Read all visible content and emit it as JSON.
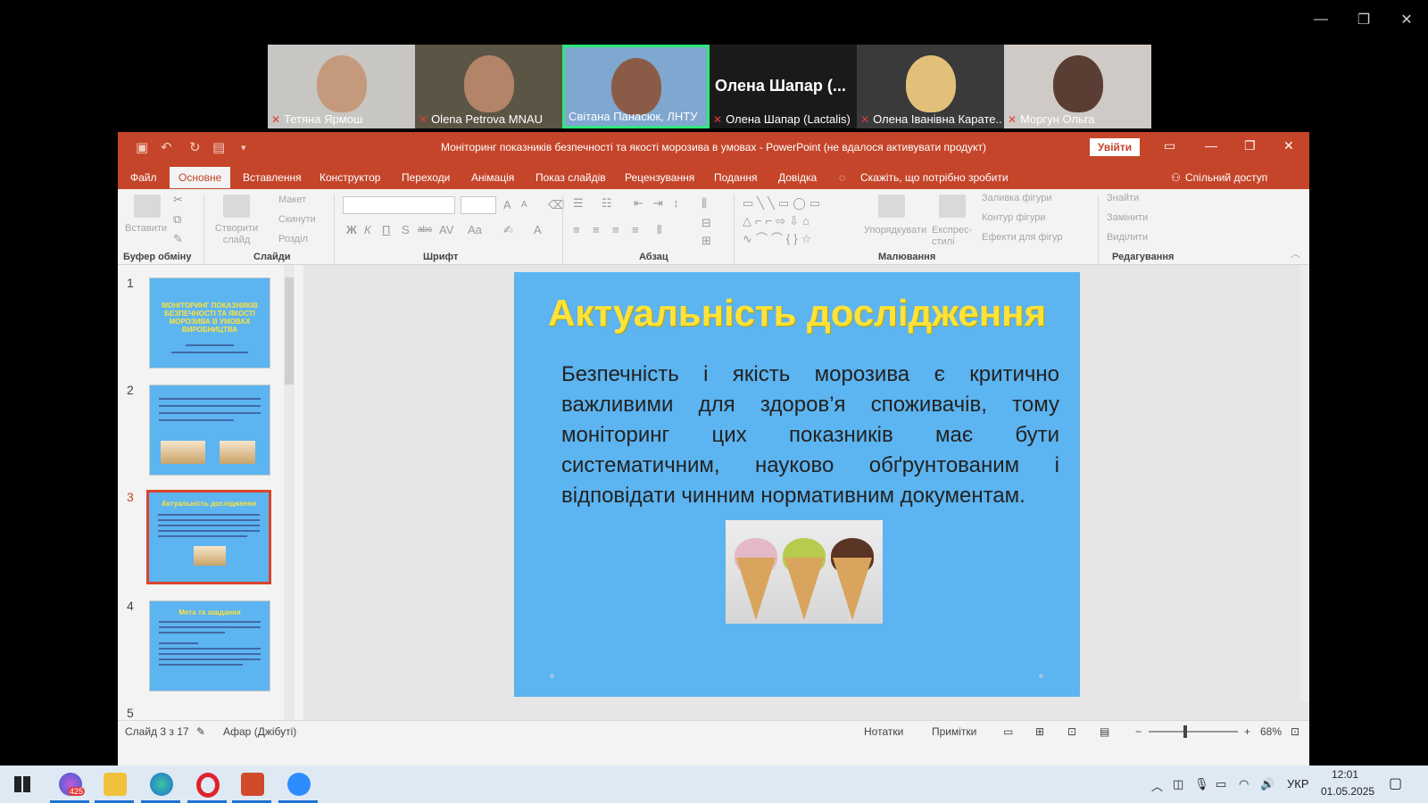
{
  "window_controls": {
    "minimize": "—",
    "restore": "❐",
    "close": "✕"
  },
  "participants": [
    {
      "name": "Тетяна Ярмош",
      "muted": true,
      "face": "#c59a7c",
      "bg": "#c8c6c2"
    },
    {
      "name": "Olena Petrova MNAU",
      "muted": true,
      "face": "#b38468",
      "bg": "#5b5546"
    },
    {
      "name": "Світана Панасюк, ЛНТУ",
      "muted": false,
      "face": "#8a5c47",
      "bg": "#7fa7cf",
      "active": true
    },
    {
      "name": "Олена Шапар (Lactalis)",
      "muted": true,
      "big": "Олена Шапар (..."
    },
    {
      "name": "Олена Іванівна Карате...",
      "muted": true,
      "face": "#e3c07a",
      "bg": "#3a3a3a"
    },
    {
      "name": "Моргун Ольга",
      "muted": true,
      "face": "#5a3e34",
      "bg": "#cfcac6"
    }
  ],
  "ppt": {
    "title": "Моніторинг показників безпечності та якості морозива в умовах  -  PowerPoint (не вдалося активувати продукт)",
    "signin": "Увійти",
    "tabs": [
      "Файл",
      "Основне",
      "Вставлення",
      "Конструктор",
      "Переходи",
      "Анімація",
      "Показ слайдів",
      "Рецензування",
      "Подання",
      "Довідка"
    ],
    "tell_me": "Скажіть, що потрібно зробити",
    "share": "Спільний доступ",
    "ribbon": {
      "clipboard": {
        "label": "Буфер обміну",
        "paste": "Вставити"
      },
      "slides": {
        "label": "Слайди",
        "new": "Створити слайд",
        "layout": "Макет",
        "reset": "Скинути",
        "section": "Розділ"
      },
      "font": {
        "label": "Шрифт",
        "bold": "Ж",
        "italic": "К",
        "underline": "П",
        "strike": "S",
        "shadow": "abc",
        "spacing": "AV",
        "case": "Aa"
      },
      "paragraph": {
        "label": "Абзац"
      },
      "drawing": {
        "label": "Малювання",
        "arrange": "Упорядкувати",
        "styles": "Експрес-стилі",
        "fill": "Заливка фігури",
        "outline": "Контур фігури",
        "effects": "Ефекти для фігур"
      },
      "editing": {
        "label": "Редагування",
        "find": "Знайти",
        "replace": "Замінити",
        "select": "Виділити"
      }
    },
    "thumbnails": [
      {
        "num": "1",
        "title": "МОНІТОРИНГ ПОКАЗНИКІВ БЕЗПЕЧНОСТІ ТА ЯКОСТІ МОРОЗИВА В УМОВАХ ВИРОБНИЦТВА"
      },
      {
        "num": "2",
        "title": ""
      },
      {
        "num": "3",
        "title": "Актуальність дослідження",
        "selected": true
      },
      {
        "num": "4",
        "title": "Мета та завдання"
      },
      {
        "num": "5",
        "title": ""
      }
    ],
    "slide": {
      "title": "Актуальність дослідження",
      "body": "Безпечність і якість морозива є критично важливими для здоров’я споживачів, тому моніторинг цих показників має бути систематичним, науково обґрунтованим і відповідати чинним нормативним документам."
    },
    "status": {
      "slide": "Слайд 3 з 17",
      "language": "Афар (Джібуті)",
      "notes": "Нотатки",
      "comments": "Примітки",
      "zoom": "68%"
    }
  },
  "taskbar": {
    "lang": "УКР",
    "time": "12:01",
    "date": "01.05.2025",
    "badge": "425"
  }
}
